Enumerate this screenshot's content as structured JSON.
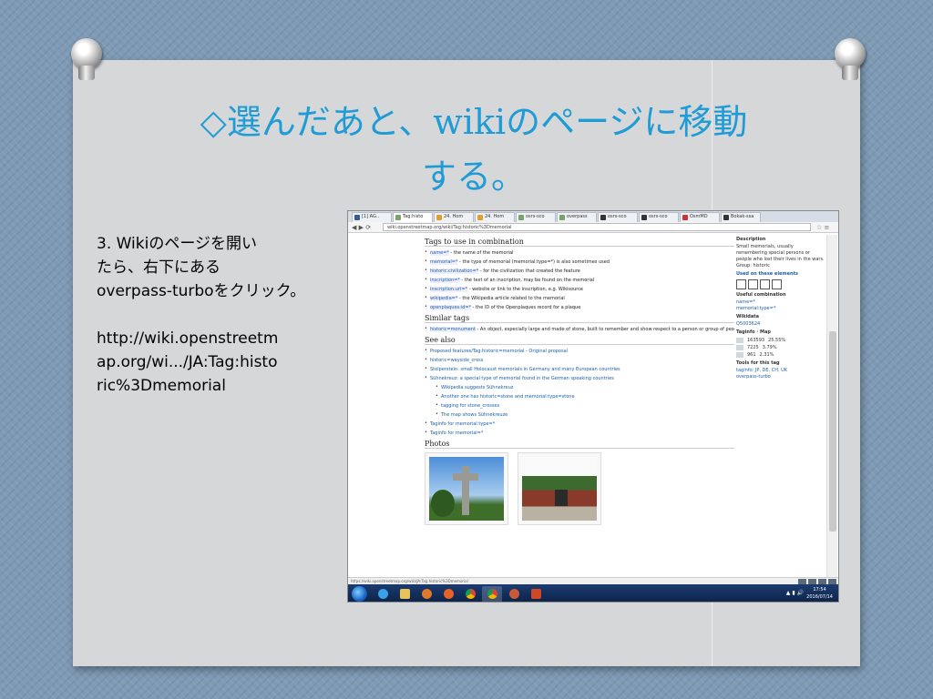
{
  "slide": {
    "title_line1": "◇選んだあと、wikiのページに移動",
    "title_line2": "する。",
    "body_lines": [
      "3. Wikiのページを開い",
      "たら、右下にある",
      "overpass-turboをクリック。",
      "",
      "http://wiki.openstreetm",
      "ap.org/wi.../JA:Tag:histo",
      "ric%3Dmemorial"
    ]
  },
  "browser": {
    "tabs": [
      {
        "label": "[1] AG..",
        "color": "#3b5998"
      },
      {
        "label": "Tag:histo",
        "color": "#7aa36b",
        "active": true
      },
      {
        "label": "24. Hom",
        "color": "#e0a030"
      },
      {
        "label": "24. Hom",
        "color": "#e0a030"
      },
      {
        "label": "osrs-sco",
        "color": "#7aa36b"
      },
      {
        "label": "overpass",
        "color": "#7aa36b"
      },
      {
        "label": "osrs-sco",
        "color": "#333333"
      },
      {
        "label": "osrs-sco",
        "color": "#333333"
      },
      {
        "label": "OsmMD",
        "color": "#cc3333"
      },
      {
        "label": "Bokak-ssa",
        "color": "#333333"
      }
    ],
    "url": "wiki.openstreetmap.org/wiki/Tag:historic%3Dmemorial",
    "sections": {
      "combination_heading": "Tags to use in combination",
      "similar_heading": "Similar tags",
      "seealso_heading": "See also",
      "photos_heading": "Photos"
    },
    "combination_items": [
      {
        "key": "name=*",
        "text": " - the name of the memorial"
      },
      {
        "key": "memorial=*",
        "text": " - the type of memorial (memorial:type=*) is also sometimes used"
      },
      {
        "key": "historic:civilization=*",
        "text": " - for the civilization that created the feature"
      },
      {
        "key": "inscription=*",
        "text": " - the text of an inscription, may be found on the memorial"
      },
      {
        "key": "inscription:url=*",
        "text": " - website or link to the inscription, e.g. Wikisource"
      },
      {
        "key": "wikipedia=*",
        "text": " - the Wikipedia article related to the memorial"
      },
      {
        "key": "openplaques:id=*",
        "text": " - the ID of the Openplaques record for a plaque"
      }
    ],
    "similar_items": [
      {
        "key": "historic=monument",
        "text": " - An object, especially large and made of stone, built to remember and show respect to a person or group of people"
      }
    ],
    "seealso_items": [
      {
        "text": "Proposed features/Tag:historic=memorial - Original proposal",
        "sub": false
      },
      {
        "text": "historic=wayside_cross",
        "sub": false
      },
      {
        "text": "Stolperstein: small Holocaust memorials in Germany and many European countries",
        "sub": false
      },
      {
        "text": "Sühnekreuz: a special type of memorial found in the German speaking countries",
        "sub": false
      },
      {
        "text": "Wikipedia suggests Sühnekreuz",
        "sub": true
      },
      {
        "text": "Another one has historic=stone and memorial:type=stone",
        "sub": true
      },
      {
        "text": "tagging for stone_crosses",
        "sub": true
      },
      {
        "text": "The map shows Sühnekreuze",
        "sub": true
      },
      {
        "text": "Taginfo for memorial:type=*",
        "sub": false
      },
      {
        "text": "Taginfo for memorial=*",
        "sub": false
      }
    ],
    "sidebar": {
      "description_label": "Description",
      "description_text": "Small memorials, usually remembering special persons or people who lost their lives in the wars.",
      "group_label": "Group: historic",
      "used_on_label": "Used on these elements",
      "useful_label": "Useful combination",
      "useful_items": [
        "name=*",
        "memorial:type=*"
      ],
      "wikidata_label": "Wikidata",
      "wikidata_id": "Q5003624",
      "taginfo_label": "Taginfo · Map",
      "stats": [
        {
          "count": "163593",
          "pct": "25.55%"
        },
        {
          "count": "7225",
          "pct": "3.79%"
        },
        {
          "count": "961",
          "pct": "2.31%"
        }
      ],
      "tools_label": "Tools for this tag",
      "tools_items": [
        "taginfo: JP, DE, CH, UK",
        "overpass-turbo"
      ]
    },
    "status_text": "https://wiki.openstreetmap.org/wiki/JA:Tag:historic%3Dmemorial",
    "clock_time": "17:54",
    "clock_date": "2016/07/14"
  }
}
